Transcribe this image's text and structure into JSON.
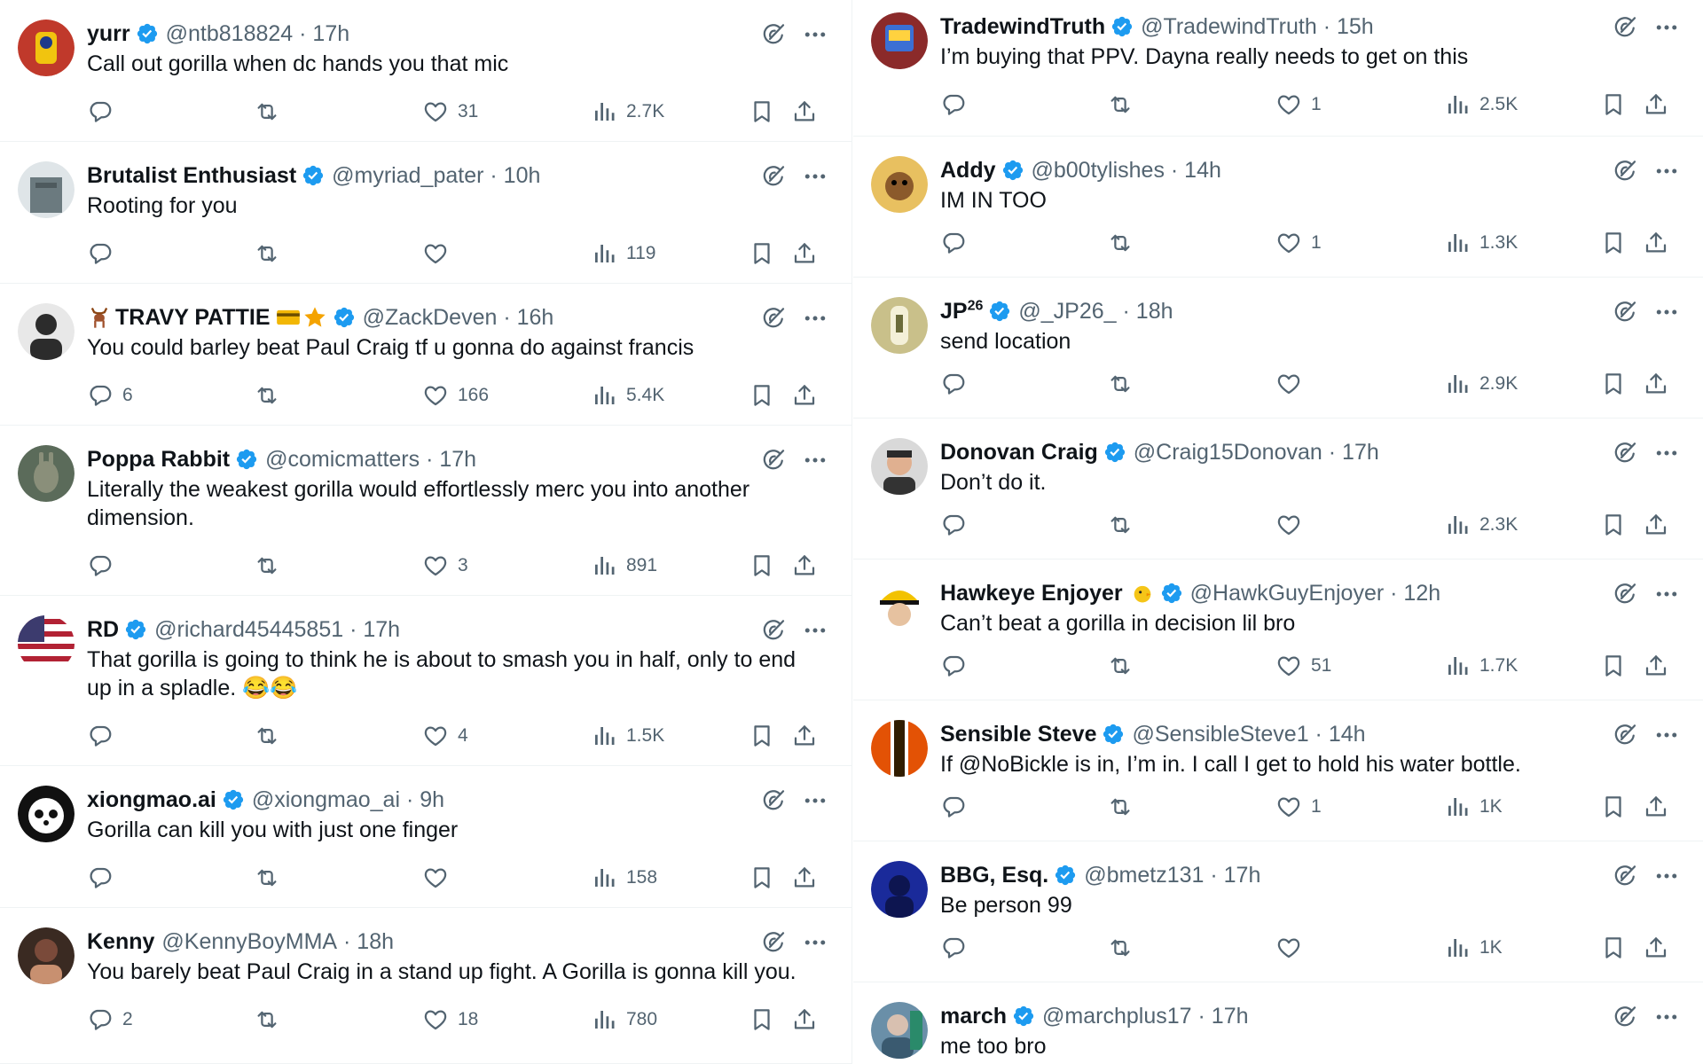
{
  "colors": {
    "accent": "#1d9bf0",
    "text": "#0f1419",
    "muted": "#536471",
    "divider": "#eff3f4"
  },
  "icons": [
    "verified-badge-icon",
    "grok-icon",
    "more-icon",
    "reply-icon",
    "retweet-icon",
    "like-icon",
    "views-icon",
    "bookmark-icon",
    "share-icon"
  ],
  "left_column": [
    {
      "name": "yurr",
      "handle": "@ntb818824",
      "time": "· 17h",
      "text": "Call out gorilla when dc hands you that mic",
      "replies": "",
      "likes": "31",
      "views": "2.7K",
      "avatar_color": "#c0392b"
    },
    {
      "name": "Brutalist Enthusiast",
      "handle": "@myriad_pater",
      "time": "· 10h",
      "text": "Rooting for you",
      "replies": "",
      "likes": "",
      "views": "119",
      "avatar_color": "#6b7a7f"
    },
    {
      "name": "TRAVY PATTIE",
      "handle": "@ZackDeven",
      "time": "· 16h",
      "text": "You could barley beat Paul Craig tf u gonna do against francis",
      "replies": "6",
      "likes": "166",
      "views": "5.4K",
      "avatar_color": "#2c2c2c"
    },
    {
      "name": "Poppa Rabbit",
      "handle": "@comicmatters",
      "time": "· 17h",
      "text": "Literally the weakest gorilla would effortlessly merc you into another dimension.",
      "replies": "",
      "likes": "3",
      "views": "891",
      "avatar_color": "#5b6b5a"
    },
    {
      "name": "RD",
      "handle": "@richard45445851",
      "time": "· 17h",
      "text": "That gorilla is going to think he is about to smash you in half, only to end up in a spladle. 😂😂",
      "replies": "",
      "likes": "4",
      "views": "1.5K",
      "avatar_color": "#b22234"
    },
    {
      "name": "xiongmao.ai",
      "handle": "@xiongmao_ai",
      "time": "· 9h",
      "text": "Gorilla can kill you with just one finger",
      "replies": "",
      "likes": "",
      "views": "158",
      "avatar_color": "#111111"
    },
    {
      "name": "Kenny",
      "handle": "@KennyBoyMMA",
      "time": "· 18h",
      "text": "You barely beat Paul Craig in a stand up fight. A Gorilla is gonna kill you.",
      "replies": "2",
      "likes": "18",
      "views": "780",
      "avatar_color": "#7a4a3a"
    }
  ],
  "right_column": [
    {
      "name": "TradewindTruth",
      "handle": "@TradewindTruth",
      "time": "· 15h",
      "text": "I’m buying that PPV.  Dayna really needs to get on this",
      "replies": "",
      "likes": "1",
      "views": "2.5K",
      "avatar_color": "#8b2a2a"
    },
    {
      "name": "Addy",
      "handle": "@b00tylishes",
      "time": "· 14h",
      "text": "IM IN TOO",
      "replies": "",
      "likes": "1",
      "views": "1.3K",
      "avatar_color": "#e8c060"
    },
    {
      "name": "JP",
      "name_sup": "26",
      "handle": "@_JP26_",
      "time": "· 18h",
      "text": "send location",
      "replies": "",
      "likes": "",
      "views": "2.9K",
      "avatar_color": "#c9c08a"
    },
    {
      "name": "Donovan Craig",
      "handle": "@Craig15Donovan",
      "time": "· 17h",
      "text": "Don’t do it.",
      "replies": "",
      "likes": "",
      "views": "2.3K",
      "avatar_color": "#d9d9d9"
    },
    {
      "name": "Hawkeye Enjoyer",
      "handle": "@HawkGuyEnjoyer",
      "time": "· 12h",
      "text": "Can’t beat a gorilla in decision lil bro",
      "replies": "",
      "likes": "51",
      "views": "1.7K",
      "avatar_color": "#f2c200"
    },
    {
      "name": "Sensible Steve",
      "handle": "@SensibleSteve1",
      "time": "· 14h",
      "text": "If @NoBickle is in, I’m in. I call I get to hold his water bottle.",
      "replies": "",
      "likes": "1",
      "views": "1K",
      "avatar_color": "#e35205"
    },
    {
      "name": "BBG, Esq.",
      "handle": "@bmetz131",
      "time": "· 17h",
      "text": "Be person 99",
      "replies": "",
      "likes": "",
      "views": "1K",
      "avatar_color": "#1a2a9a"
    },
    {
      "name": "march",
      "handle": "@marchplus17",
      "time": "· 17h",
      "text": "me too bro",
      "replies": "",
      "likes": "",
      "views": "",
      "avatar_color": "#6a8fa8"
    }
  ]
}
